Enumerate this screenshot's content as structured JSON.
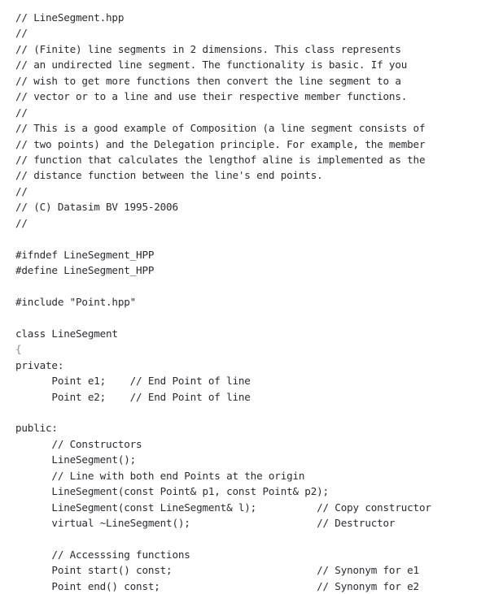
{
  "document": {
    "kind": "source-code-listing",
    "language": "C++",
    "file_name": "LineSegment.hpp",
    "copyright": "(C) Datasim BV 1995-2006",
    "background_color": "#ffffff",
    "text_color": "#2b2b2e",
    "faint_text_color": "#8c8c92"
  },
  "lines": [
    {
      "text": "// LineSegment.hpp",
      "style": "normal"
    },
    {
      "text": "//",
      "style": "normal"
    },
    {
      "text": "// (Finite) line segments in 2 dimensions. This class represents",
      "style": "normal"
    },
    {
      "text": "// an undirected line segment. The functionality is basic. If you",
      "style": "normal"
    },
    {
      "text": "// wish to get more functions then convert the line segment to a",
      "style": "normal"
    },
    {
      "text": "// vector or to a line and use their respective member functions.",
      "style": "normal"
    },
    {
      "text": "//",
      "style": "normal"
    },
    {
      "text": "// This is a good example of Composition (a line segment consists of",
      "style": "normal"
    },
    {
      "text": "// two points) and the Delegation principle. For example, the member",
      "style": "normal"
    },
    {
      "text": "// function that calculates the lengthof aline is implemented as the",
      "style": "normal"
    },
    {
      "text": "// distance function between the line's end points.",
      "style": "normal"
    },
    {
      "text": "//",
      "style": "normal"
    },
    {
      "text": "// (C) Datasim BV 1995-2006",
      "style": "normal"
    },
    {
      "text": "//",
      "style": "normal"
    },
    {
      "text": "",
      "style": "blank"
    },
    {
      "text": "#ifndef LineSegment_HPP",
      "style": "normal"
    },
    {
      "text": "#define LineSegment_HPP",
      "style": "normal"
    },
    {
      "text": "",
      "style": "blank"
    },
    {
      "text": "#include \"Point.hpp\"",
      "style": "normal"
    },
    {
      "text": "",
      "style": "blank"
    },
    {
      "text": "class LineSegment",
      "style": "normal"
    },
    {
      "text": "{",
      "style": "faint"
    },
    {
      "text": "private:",
      "style": "normal"
    },
    {
      "text": "      Point e1;    // End Point of line",
      "style": "normal"
    },
    {
      "text": "      Point e2;    // End Point of line",
      "style": "normal"
    },
    {
      "text": "",
      "style": "blank"
    },
    {
      "text": "public:",
      "style": "normal"
    },
    {
      "text": "      // Constructors",
      "style": "normal"
    },
    {
      "text": "      LineSegment();",
      "style": "normal"
    },
    {
      "text": "      // Line with both end Points at the origin",
      "style": "normal"
    },
    {
      "text": "      LineSegment(const Point& p1, const Point& p2);",
      "style": "normal"
    },
    {
      "text": "      LineSegment(const LineSegment& l);          // Copy constructor",
      "style": "normal"
    },
    {
      "text": "      virtual ~LineSegment();                     // Destructor",
      "style": "normal"
    },
    {
      "text": "",
      "style": "blank"
    },
    {
      "text": "      // Accesssing functions",
      "style": "normal"
    },
    {
      "text": "      Point start() const;                        // Synonym for e1",
      "style": "normal"
    },
    {
      "text": "      Point end() const;                          // Synonym for e2",
      "style": "normal"
    }
  ]
}
